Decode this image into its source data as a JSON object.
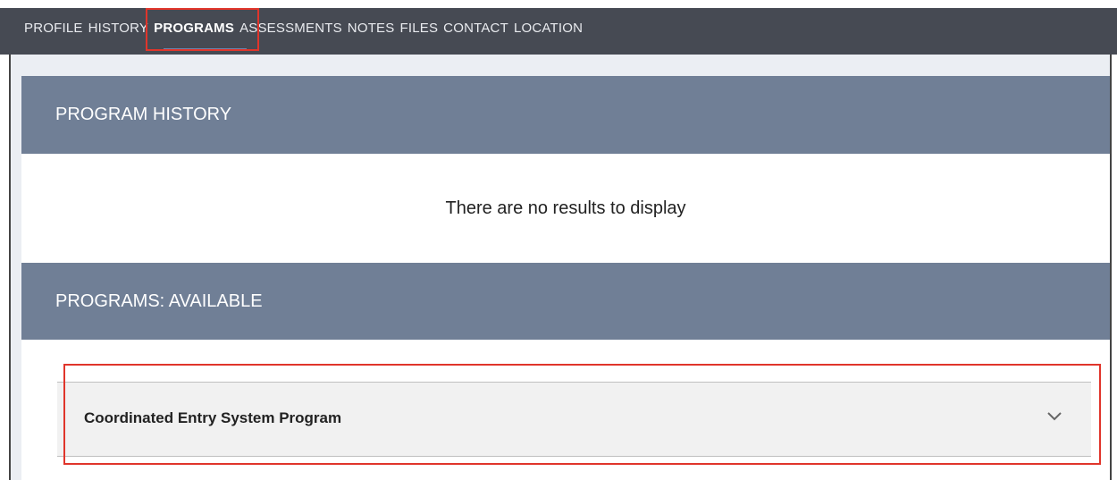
{
  "nav": {
    "tabs": [
      {
        "label": "PROFILE"
      },
      {
        "label": "HISTORY"
      },
      {
        "label": "PROGRAMS",
        "active": true
      },
      {
        "label": "ASSESSMENTS"
      },
      {
        "label": "NOTES"
      },
      {
        "label": "FILES"
      },
      {
        "label": "CONTACT"
      },
      {
        "label": "LOCATION"
      }
    ]
  },
  "program_history": {
    "title": "PROGRAM HISTORY",
    "empty_message": "There are no results to display"
  },
  "programs_available": {
    "title": "PROGRAMS: AVAILABLE",
    "items": [
      {
        "label": "Coordinated Entry System Program",
        "icon": "chevron-down-icon"
      }
    ]
  },
  "colors": {
    "highlight": "#e0352b",
    "header": "#707f96",
    "topbar": "#464a53",
    "active_underline": "#6a84b0"
  }
}
